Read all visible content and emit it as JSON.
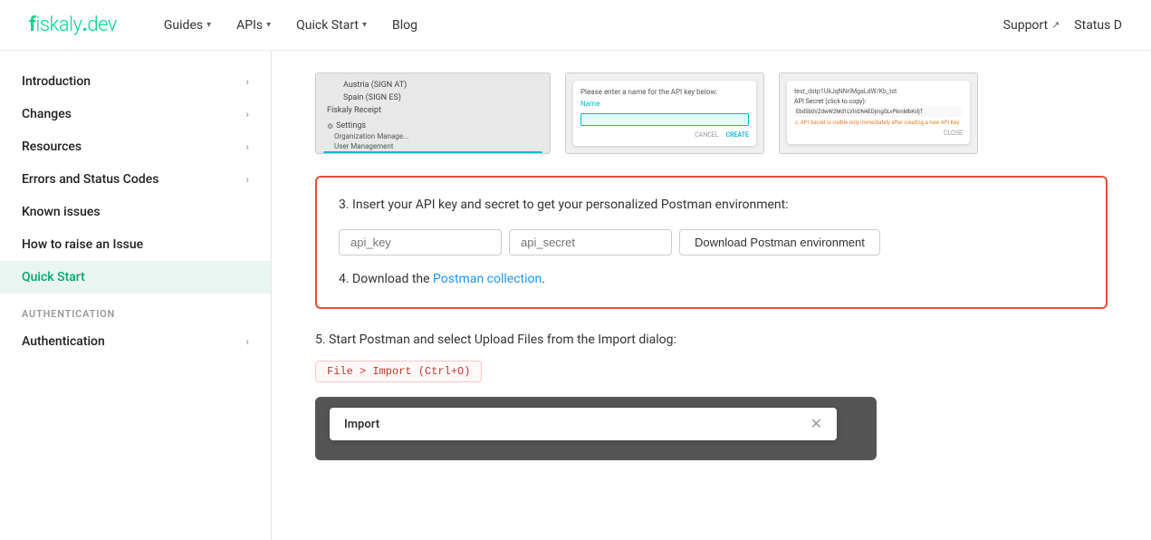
{
  "brand": {
    "name_bold": "fiskaly",
    "name_dot": ".",
    "name_suffix": "dev"
  },
  "topnav": {
    "links": [
      {
        "label": "Guides",
        "has_dropdown": true
      },
      {
        "label": "APIs",
        "has_dropdown": true
      },
      {
        "label": "Quick Start",
        "has_dropdown": true
      },
      {
        "label": "Blog",
        "has_dropdown": false
      }
    ],
    "right_links": [
      {
        "label": "Support",
        "has_ext": true
      },
      {
        "label": "Status D",
        "has_ext": false
      }
    ]
  },
  "sidebar": {
    "items": [
      {
        "label": "Introduction",
        "active": false,
        "has_chevron": true
      },
      {
        "label": "Changes",
        "active": false,
        "has_chevron": true
      },
      {
        "label": "Resources",
        "active": false,
        "has_chevron": true
      },
      {
        "label": "Errors and Status Codes",
        "active": false,
        "has_chevron": true
      },
      {
        "label": "Known issues",
        "active": false,
        "has_chevron": false
      },
      {
        "label": "How to raise an Issue",
        "active": false,
        "has_chevron": false
      },
      {
        "label": "Quick Start",
        "active": true,
        "has_chevron": false
      }
    ],
    "section_label": "AUTHENTICATION",
    "auth_items": [
      {
        "label": "Authentication",
        "active": false,
        "has_chevron": true
      }
    ]
  },
  "content": {
    "step3_text": "3. Insert your API key and secret to get your personalized Postman environment:",
    "api_key_placeholder": "api_key",
    "api_secret_placeholder": "api_secret",
    "download_button_label": "Download Postman environment",
    "step4_prefix": "4. Download the ",
    "step4_link": "Postman collection",
    "step4_suffix": ".",
    "step5_text": "5. Start Postman and select Upload Files from the Import dialog:",
    "code_label": "File > Import (Ctrl+O)",
    "import_dialog_title": "Import",
    "import_close": "✕"
  }
}
